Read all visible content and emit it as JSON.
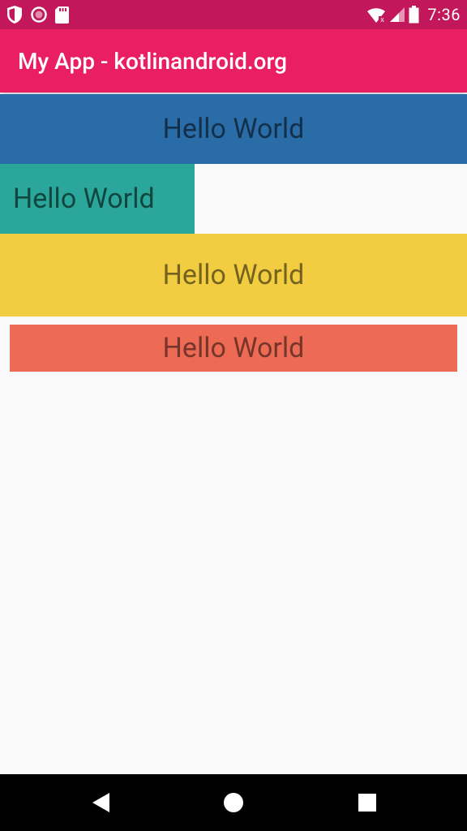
{
  "status": {
    "time": "7:36"
  },
  "app": {
    "title": "My App - kotlinandroid.org"
  },
  "rows": {
    "r1": {
      "text": "Hello World",
      "bg": "#2a6ca7"
    },
    "r2": {
      "text": "Hello World",
      "bg": "#2aa79a"
    },
    "r3": {
      "text": "Hello World",
      "bg": "#f3cd41"
    },
    "r4": {
      "text": "Hello World",
      "bg": "#ed6b54"
    }
  },
  "colors": {
    "status_bg": "#c2185b",
    "appbar_bg": "#e91e63"
  }
}
